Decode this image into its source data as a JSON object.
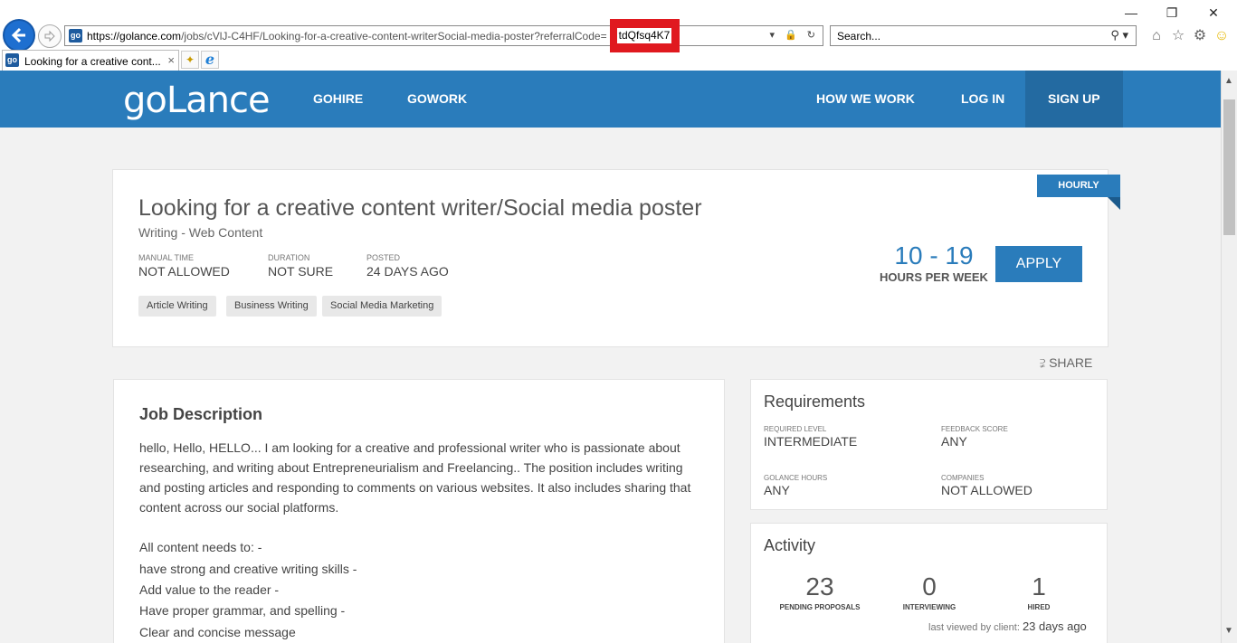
{
  "browser": {
    "url_host": "https://golance.com",
    "url_path": "/jobs/cVlJ-C4HF/Looking-for-a-creative-content-writerSocial-media-poster?referralCode=",
    "url_code": "tdQfsq4K7",
    "favicon": "go",
    "search_placeholder": "Search...",
    "tab_title": "Looking for a creative cont...",
    "tab_close": "×"
  },
  "nav": {
    "logo": "goLance",
    "links": [
      "GOHIRE",
      "GOWORK",
      "HOW WE WORK",
      "LOG IN",
      "SIGN UP"
    ]
  },
  "job": {
    "badge": "HOURLY",
    "title": "Looking for a creative content writer/Social media poster",
    "category": "Writing - Web Content",
    "meta": [
      {
        "label": "MANUAL TIME",
        "value": "NOT ALLOWED"
      },
      {
        "label": "DURATION",
        "value": "NOT SURE"
      },
      {
        "label": "POSTED",
        "value": "24 DAYS AGO"
      }
    ],
    "tags": [
      "Article Writing",
      "Business Writing",
      "Social Media Marketing"
    ],
    "hours": "10 - 19",
    "hours_label": "HOURS PER WEEK",
    "apply": "APPLY",
    "share": "SHARE"
  },
  "description": {
    "title": "Job Description",
    "intro": "hello, Hello, HELLO... I am looking for a creative and professional writer who is passionate about researching, and writing about Entrepreneurialism and Freelancing.. The position includes writing and posting articles and responding to comments on various websites. It also includes sharing that content across our social platforms.",
    "lines": [
      "All content needs to: -",
      "have strong and creative writing skills -",
      "Add value to the reader -",
      "Have proper grammar, and spelling -",
      "Clear and concise message"
    ]
  },
  "requirements": {
    "title": "Requirements",
    "items": [
      {
        "label": "REQUIRED LEVEL",
        "value": "INTERMEDIATE"
      },
      {
        "label": "FEEDBACK SCORE",
        "value": "ANY"
      },
      {
        "label": "GOLANCE HOURS",
        "value": "ANY"
      },
      {
        "label": "COMPANIES",
        "value": "NOT ALLOWED"
      }
    ]
  },
  "activity": {
    "title": "Activity",
    "stats": [
      {
        "value": "23",
        "label": "PENDING PROPOSALS"
      },
      {
        "value": "0",
        "label": "INTERVIEWING"
      },
      {
        "value": "1",
        "label": "HIRED"
      }
    ],
    "last_viewed_label": "last viewed by client:",
    "last_viewed_value": "23 days ago"
  }
}
